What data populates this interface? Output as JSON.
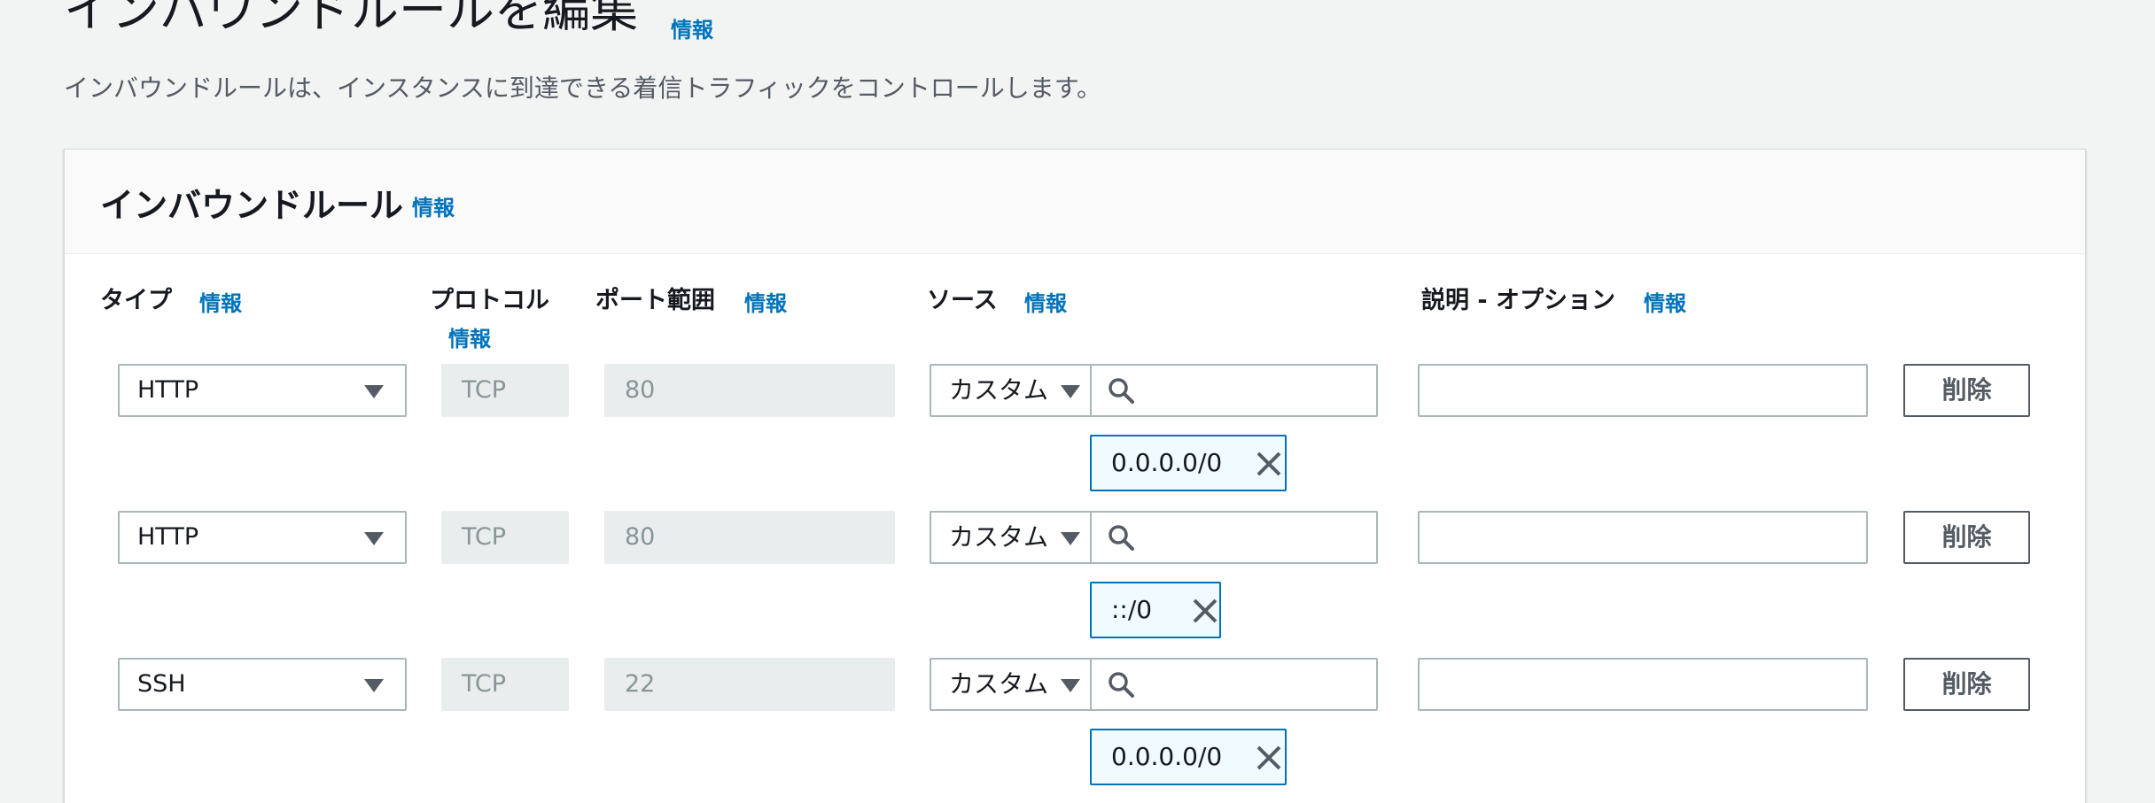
{
  "page": {
    "title": "インバウンドルールを編集",
    "info": "情報",
    "description": "インバウンドルールは、インスタンスに到達できる着信トラフィックをコントロールします。"
  },
  "panel": {
    "title": "インバウンドルール",
    "info": "情報"
  },
  "columns": {
    "type": "タイプ",
    "protocol": "プロトコル",
    "port_range": "ポート範囲",
    "source": "ソース",
    "description": "説明 - オプション",
    "info": "情報"
  },
  "rules": [
    {
      "type": "HTTP",
      "protocol": "TCP",
      "port": "80",
      "source_type": "カスタム",
      "search_placeholder": "",
      "token": "0.0.0.0/0",
      "description": "",
      "delete_label": "削除"
    },
    {
      "type": "HTTP",
      "protocol": "TCP",
      "port": "80",
      "source_type": "カスタム",
      "search_placeholder": "",
      "token": "::/0",
      "description": "",
      "delete_label": "削除"
    },
    {
      "type": "SSH",
      "protocol": "TCP",
      "port": "22",
      "source_type": "カスタム",
      "search_placeholder": "",
      "token": "0.0.0.0/0",
      "description": "",
      "delete_label": "削除"
    }
  ],
  "colors": {
    "link": "#0073bb",
    "background": "#f2f3f3",
    "token_bg": "#f1faff",
    "disabled_bg": "#eaeded"
  }
}
